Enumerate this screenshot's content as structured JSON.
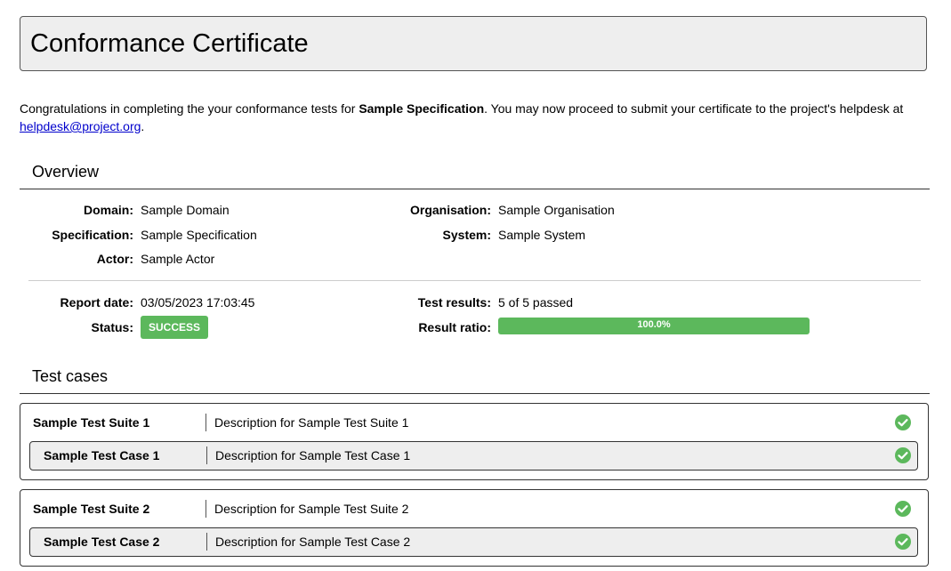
{
  "title": "Conformance Certificate",
  "intro": {
    "text_before": "Congratulations in completing the your conformance tests for ",
    "spec_name": "Sample Specification",
    "text_after": ". You may now proceed to submit your certificate to the project's helpdesk at",
    "email": "helpdesk@project.org",
    "trailing": "."
  },
  "overview": {
    "heading": "Overview",
    "domain_label": "Domain:",
    "domain_value": "Sample Domain",
    "specification_label": "Specification:",
    "specification_value": "Sample Specification",
    "actor_label": "Actor:",
    "actor_value": "Sample Actor",
    "organisation_label": "Organisation:",
    "organisation_value": "Sample Organisation",
    "system_label": "System:",
    "system_value": "Sample System",
    "report_date_label": "Report date:",
    "report_date_value": "03/05/2023 17:03:45",
    "status_label": "Status:",
    "status_value": "SUCCESS",
    "test_results_label": "Test results:",
    "test_results_value": "5 of 5 passed",
    "result_ratio_label": "Result ratio:",
    "result_ratio_value": "100.0%",
    "result_ratio_fraction": 1.0
  },
  "test_cases": {
    "heading": "Test cases",
    "suites": [
      {
        "name": "Sample Test Suite 1",
        "description": "Description for Sample Test Suite 1",
        "case_name": "Sample Test Case 1",
        "case_description": "Description for Sample Test Case 1"
      },
      {
        "name": "Sample Test Suite 2",
        "description": "Description for Sample Test Suite 2",
        "case_name": "Sample Test Case 2",
        "case_description": "Description for Sample Test Case 2"
      }
    ]
  },
  "colors": {
    "success": "#5cb85c",
    "header_bg": "#eeeeee",
    "link": "#0000cc"
  },
  "icons": {
    "passed": "check-circle-icon"
  }
}
